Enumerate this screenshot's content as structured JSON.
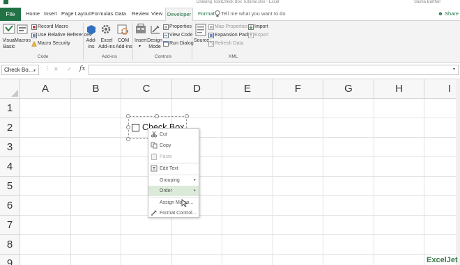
{
  "titlebar": {
    "context_label": "Drawing Tools",
    "file_name": "Check Box Tutorial.xlsx - Excel",
    "user": "Sasha Barthel"
  },
  "tabs": {
    "file": "File",
    "home": "Home",
    "insert": "Insert",
    "page_layout": "Page Layout",
    "formulas": "Formulas",
    "data": "Data",
    "review": "Review",
    "view": "View",
    "developer": "Developer",
    "format": "Format",
    "tell_me": "Tell me what you want to do",
    "share": "Share"
  },
  "ribbon": {
    "code": {
      "visual_basic": [
        "Visual",
        "Basic"
      ],
      "macros": "Macros",
      "record_macro": "Record Macro",
      "use_relative": "Use Relative References",
      "macro_security": "Macro Security",
      "group": "Code"
    },
    "addins": {
      "addins": [
        "Add-",
        "ins"
      ],
      "excel_addins": [
        "Excel",
        "Add-ins"
      ],
      "com_addins": [
        "COM",
        "Add-ins"
      ],
      "group": "Add-ins"
    },
    "controls": {
      "insert": "Insert",
      "design_mode": [
        "Design",
        "Mode"
      ],
      "properties": "Properties",
      "view_code": "View Code",
      "run_dialog": "Run Dialog",
      "group": "Controls"
    },
    "xml": {
      "source": "Source",
      "map_properties": "Map Properties",
      "expansion_packs": "Expansion Packs",
      "refresh_data": "Refresh Data",
      "import": "Import",
      "export": "Export",
      "group": "XML"
    }
  },
  "formula_bar": {
    "name_box": "Check Bo…",
    "fx": "fx",
    "value": ""
  },
  "sheet": {
    "columns": [
      "A",
      "B",
      "C",
      "D",
      "E",
      "F",
      "G",
      "H",
      "I"
    ],
    "rows": [
      "1",
      "2",
      "3",
      "4",
      "5",
      "6",
      "7",
      "8",
      "9"
    ]
  },
  "checkbox": {
    "label": "Check Box",
    "checked": false
  },
  "context_menu": {
    "items": [
      {
        "label": "Cut",
        "enabled": true
      },
      {
        "label": "Copy",
        "enabled": true
      },
      {
        "label": "Paste",
        "enabled": false
      },
      {
        "label": "Edit Text",
        "enabled": true
      },
      {
        "label": "Grouping",
        "enabled": true,
        "submenu": true
      },
      {
        "label": "Order",
        "enabled": true,
        "submenu": true,
        "highlighted": true
      },
      {
        "label": "Assign Macro...",
        "enabled": true
      },
      {
        "label": "Format Control...",
        "enabled": true
      }
    ]
  },
  "colors": {
    "accent": "#217346",
    "menu_highlight": "#dcebd9"
  },
  "watermark": "ExcelJet"
}
